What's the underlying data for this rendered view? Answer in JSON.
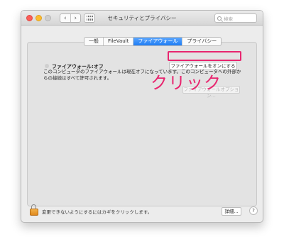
{
  "window": {
    "title": "セキュリティとプライバシー",
    "search_placeholder": "検索",
    "back_glyph": "‹",
    "forward_glyph": "›"
  },
  "tabs": [
    {
      "label": "一般",
      "active": false
    },
    {
      "label": "FileVault",
      "active": false
    },
    {
      "label": "ファイアウォール",
      "active": true
    },
    {
      "label": "プライバシー",
      "active": false
    }
  ],
  "firewall": {
    "status": "ファイアウォール:オフ",
    "turn_on_button": "ファイアウォールをオンにする",
    "description": "このコンピュータのファイアウォールは現在オフになっています。このコンピュータへの外部からの接続はすべて許可されます。",
    "options_button": "ファイアウォールオプション..."
  },
  "annotation": {
    "text": "クリック",
    "color": "#e8266f"
  },
  "footer": {
    "lock_text": "変更できないようにするにはカギをクリックします。",
    "details_button": "詳細...",
    "help_button": "?"
  },
  "colors": {
    "tab_active": "#1f7cf4",
    "highlight": "#e8266f"
  },
  "icons": [
    "back-arrow-icon",
    "forward-arrow-icon",
    "grid-icon",
    "search-icon",
    "lock-icon",
    "status-dot-icon"
  ]
}
